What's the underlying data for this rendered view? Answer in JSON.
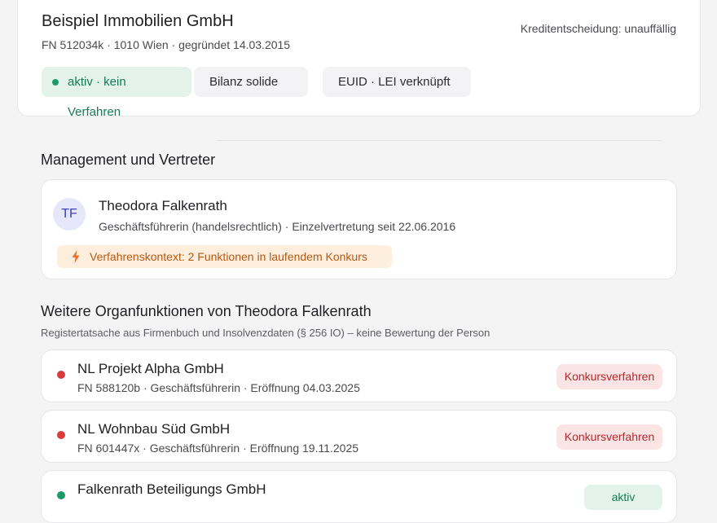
{
  "company": {
    "name": "Beispiel Immobilien GmbH",
    "meta": "FN 512034k · 1010 Wien · gegründet 14.03.2015",
    "credit_decision": "Kreditentscheidung: unauffällig",
    "chips": {
      "status": "aktiv · kein Verfahren",
      "bilanz": "Bilanz solide",
      "euid": "EUID · LEI verknüpft"
    }
  },
  "management": {
    "title": "Management und Vertreter",
    "person": {
      "initials": "TF",
      "name": "Theodora Falkenrath",
      "role": "Geschäftsführerin (handelsrechtlich) · Einzelvertretung seit 22.06.2016",
      "context": "Verfahrenskontext: 2 Funktionen in laufendem Konkurs"
    }
  },
  "further_functions": {
    "title": "Weitere Organfunktionen von Theodora Falkenrath",
    "subtitle": "Registertatsache aus Firmenbuch und Insolvenzdaten (§ 256 IO) – keine Bewertung der Person",
    "items": [
      {
        "name": "NL Projekt Alpha GmbH",
        "meta": "FN 588120b · Geschäftsführerin · Eröffnung 04.03.2025",
        "badge": "Konkursverfahren",
        "status_color": "#d93a3a"
      },
      {
        "name": "NL Wohnbau Süd GmbH",
        "meta": "FN 601447x · Geschäftsführerin · Eröffnung 19.11.2025",
        "badge": "Konkursverfahren",
        "status_color": "#d93a3a"
      },
      {
        "name": "Falkenrath Beteiligungs GmbH",
        "meta": "",
        "badge": "aktiv",
        "status_color": "#1d9a68"
      }
    ]
  },
  "colors": {
    "accent_green": "#1d9a68",
    "alert_red": "#d93a3a",
    "warning_orange": "#e8702a"
  }
}
